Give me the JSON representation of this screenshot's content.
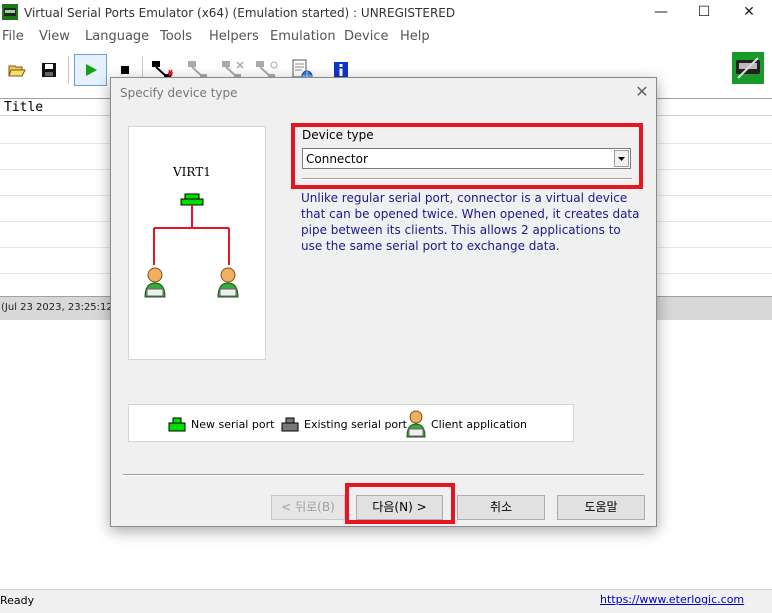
{
  "window": {
    "title": "Virtual Serial Ports Emulator (x64) (Emulation started) : UNREGISTERED",
    "minimize": "—",
    "maximize": "☐",
    "close": "✕"
  },
  "menu": [
    "File",
    "View",
    "Language",
    "Tools",
    "Helpers",
    "Emulation",
    "Device",
    "Help"
  ],
  "list": {
    "header": "Title"
  },
  "log": {
    "first_line": "(Jul 23 2023, 23:25:12"
  },
  "status": {
    "left": "Ready",
    "link": "https://www.eterlogic.com"
  },
  "dialog": {
    "title": "Specify device type",
    "close": "✕",
    "diagram_label": "VIRT1",
    "device_type_label": "Device type",
    "device_type_value": "Connector",
    "description": "Unlike regular serial port, connector is a virtual device that can be opened twice. When opened, it creates data pipe between its clients. This allows 2 applications to use the same serial port to exchange data.",
    "legend": {
      "new_port": "New serial port",
      "existing_port": "Existing serial port",
      "client_app": "Client application"
    },
    "buttons": {
      "back": "< 뒤로(B)",
      "next": "다음(N) >",
      "cancel": "취소",
      "help": "도움말"
    }
  },
  "colors": {
    "highlight": "#e4161f",
    "description_text": "#1a1a8c",
    "link": "#0000cc"
  }
}
